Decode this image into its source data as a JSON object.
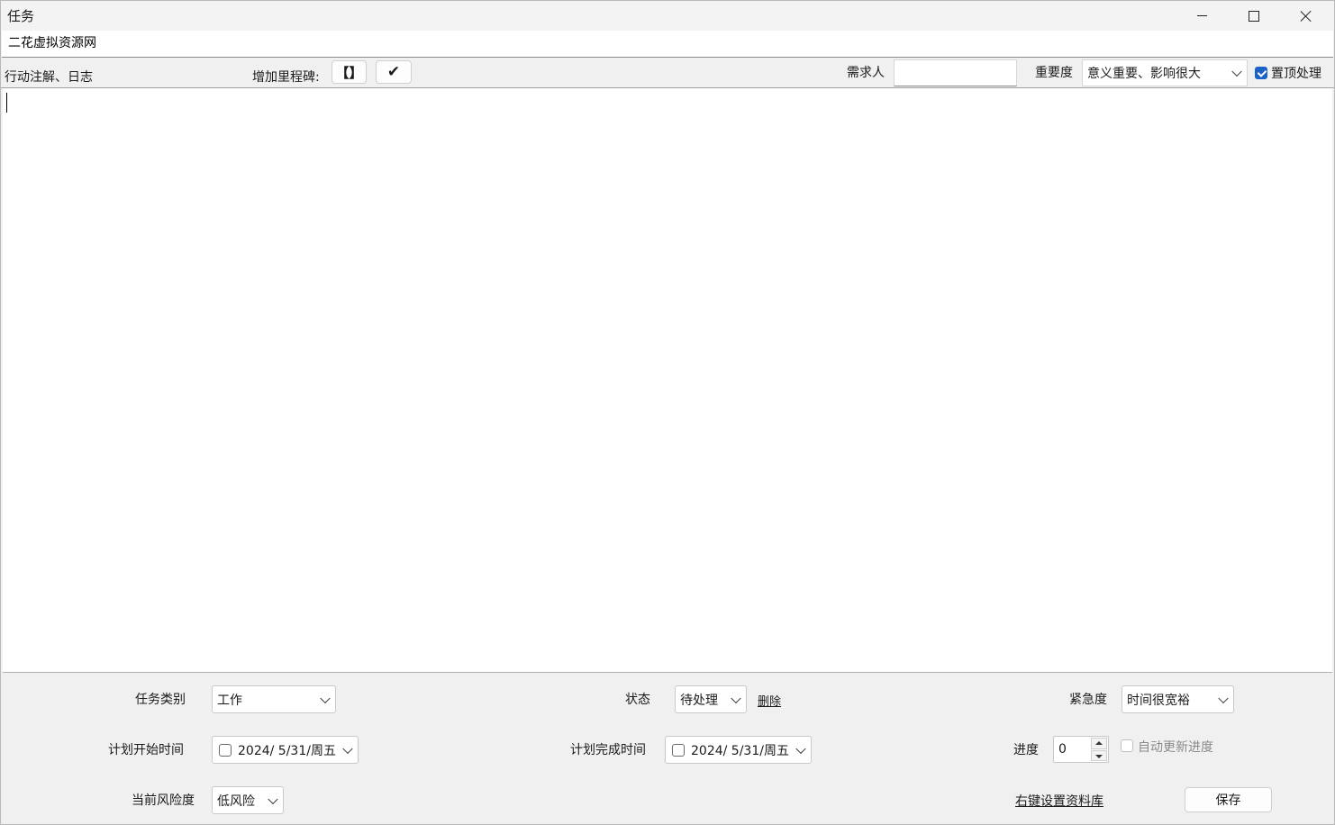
{
  "window": {
    "title": "任务",
    "controls": [
      "minimize-icon",
      "maximize-icon",
      "close-icon"
    ]
  },
  "task": {
    "title_value": "二花虚拟资源网"
  },
  "toolbar": {
    "notes_label": "行动注解、日志",
    "milestone_label": "增加里程碑:",
    "bracket_button": "【】",
    "check_button": "✔",
    "requester_label": "需求人",
    "requester_value": "",
    "importance_label": "重要度",
    "importance_value": "意义重要、影响很大",
    "pin_label": "置顶处理",
    "pin_checked": true
  },
  "editor": {
    "content": ""
  },
  "form": {
    "category_label": "任务类别",
    "category_value": "工作",
    "status_label": "状态",
    "status_value": "待处理",
    "delete_link": "删除",
    "urgency_label": "紧急度",
    "urgency_value": "时间很宽裕",
    "plan_start_label": "计划开始时间",
    "plan_start_value": "2024/  5/31/周五",
    "plan_end_label": "计划完成时间",
    "plan_end_value": "2024/  5/31/周五",
    "progress_label": "进度",
    "progress_value": "0",
    "auto_progress_label": "自动更新进度",
    "risk_label": "当前风险度",
    "risk_value": "低风险",
    "library_link": "右键设置资料库",
    "save_button": "保存"
  },
  "colors": {
    "accent": "#1a62c7",
    "window_bg": "#f0f0f0",
    "editor_bg": "#ffffff"
  }
}
